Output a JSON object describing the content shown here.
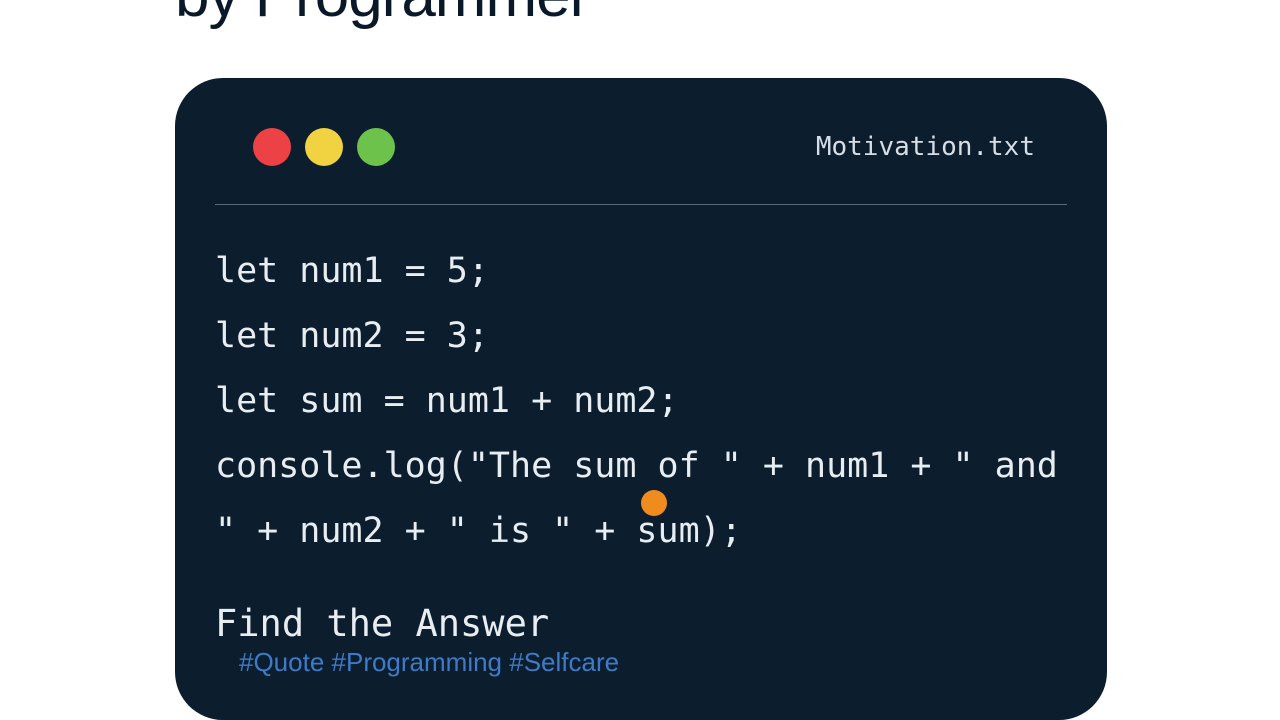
{
  "heading": "by Programmer",
  "window": {
    "filename": "Motivation.txt",
    "traffic_lights": {
      "red": "close-icon",
      "yellow": "minimize-icon",
      "green": "maximize-icon"
    }
  },
  "code": {
    "line1": "let num1 = 5;",
    "line2": "let num2 = 3;",
    "line3": "let sum = num1 + num2;",
    "line4": "console.log(\"The sum of \" + num1 + \" and \" + num2 + \" is \" + sum);"
  },
  "prompt": "Find the Answer",
  "hashtags": "#Quote #Programming #Selfcare",
  "colors": {
    "window_bg": "#0c1e2e",
    "text": "#e8edf2",
    "hashtag": "#3d7bc9",
    "cursor": "#f08c1e"
  }
}
